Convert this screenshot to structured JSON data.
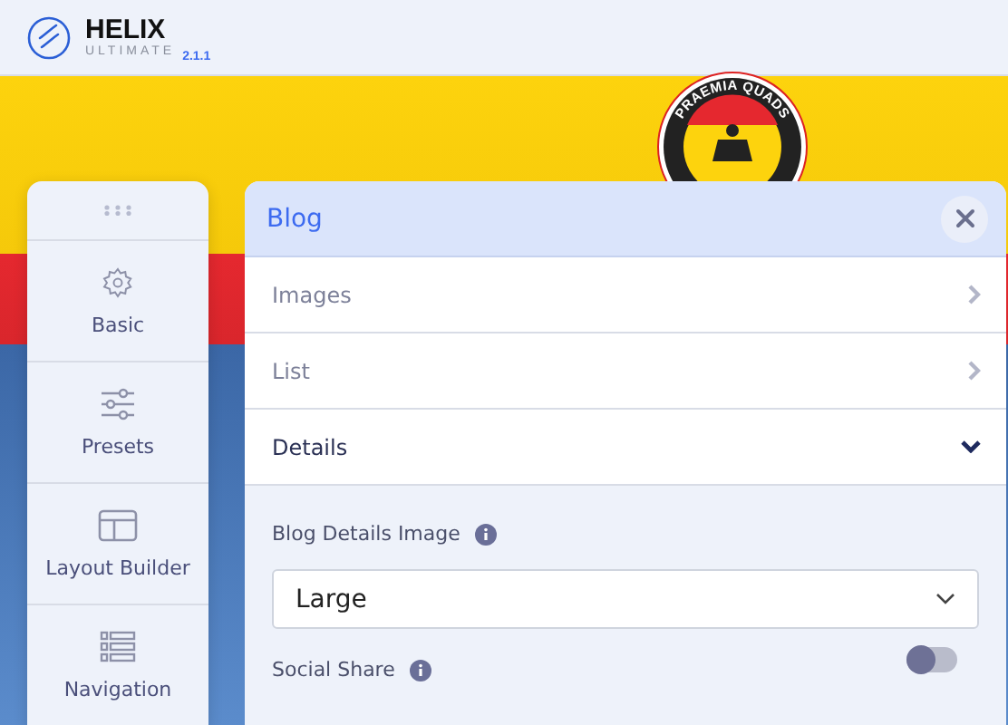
{
  "header": {
    "logo_title": "HELIX",
    "logo_subtitle": "ULTIMATE",
    "version": "2.1.1"
  },
  "site_logo": {
    "text": "PRAEMIA QUADS"
  },
  "sidebar": {
    "items": [
      {
        "label": "Basic",
        "kind": "gear",
        "selected": false
      },
      {
        "label": "Presets",
        "kind": "sliders",
        "selected": false
      },
      {
        "label": "Layout Builder",
        "kind": "layout",
        "selected": false
      },
      {
        "label": "Navigation",
        "kind": "list",
        "selected": false
      }
    ]
  },
  "panel": {
    "title": "Blog",
    "sections": [
      {
        "label": "Images",
        "expanded": false
      },
      {
        "label": "List",
        "expanded": false
      },
      {
        "label": "Details",
        "expanded": true
      }
    ],
    "fields": [
      {
        "kind": "select",
        "label": "Blog Details Image",
        "value": "Large"
      },
      {
        "kind": "toggle",
        "label": "Social Share",
        "on": false
      }
    ]
  }
}
